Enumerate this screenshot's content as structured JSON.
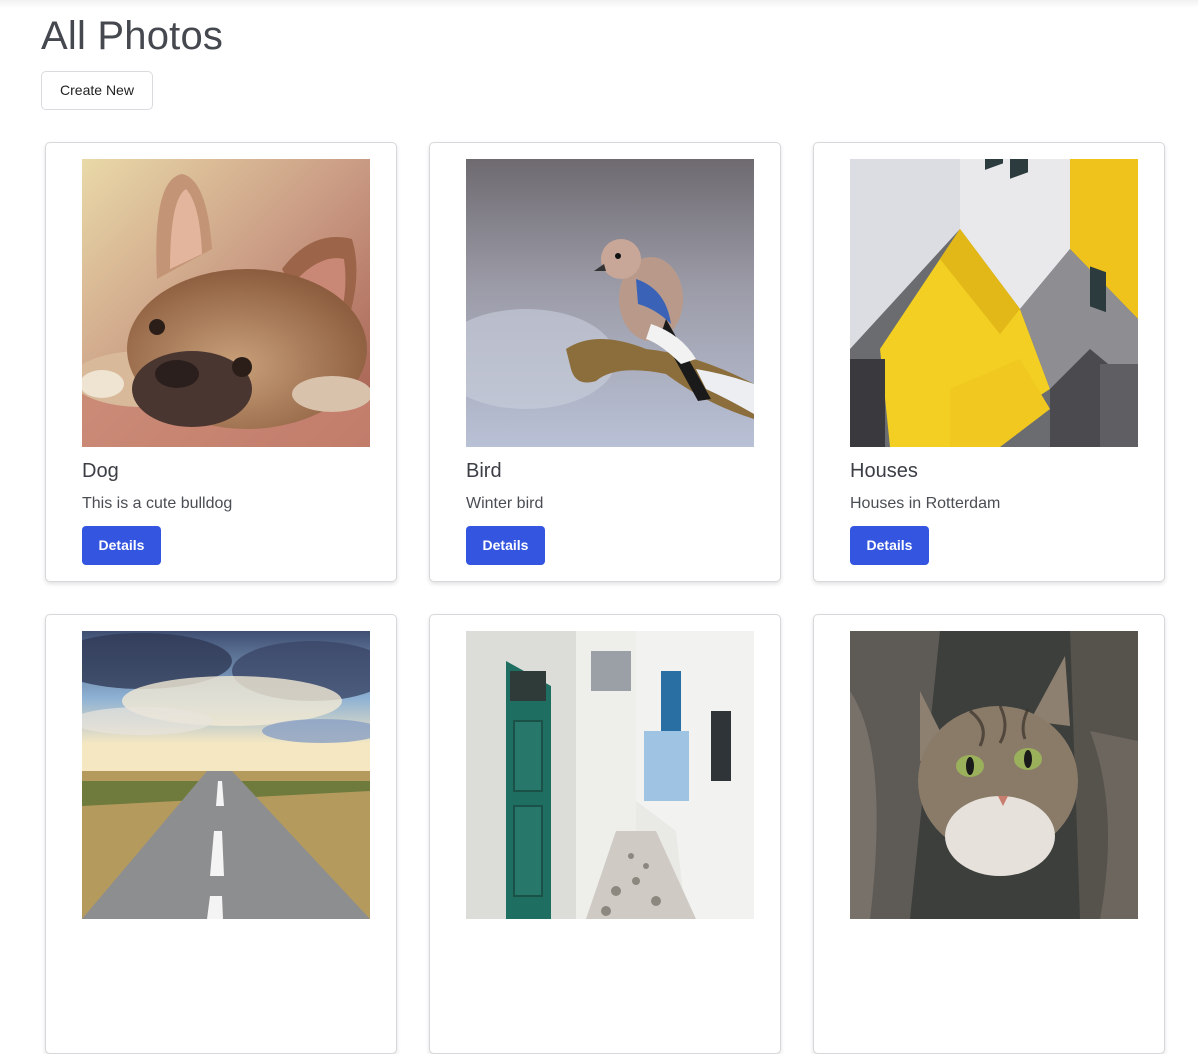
{
  "page": {
    "title": "All Photos",
    "create_label": "Create New"
  },
  "colors": {
    "accent": "#3455e0",
    "text": "#3b3f45",
    "border": "#d6d8db"
  },
  "photos": [
    {
      "title": "Dog",
      "description": "This is a cute bulldog",
      "button_label": "Details",
      "image": "french-bulldog-photo"
    },
    {
      "title": "Bird",
      "description": "Winter bird",
      "button_label": "Details",
      "image": "jay-bird-on-branch-photo"
    },
    {
      "title": "Houses",
      "description": "Houses in Rotterdam",
      "button_label": "Details",
      "image": "yellow-cube-houses-photo"
    },
    {
      "title": "",
      "description": "",
      "button_label": "",
      "image": "road-under-clouds-photo"
    },
    {
      "title": "",
      "description": "",
      "button_label": "",
      "image": "white-alley-photo"
    },
    {
      "title": "",
      "description": "",
      "button_label": "",
      "image": "tabby-kitten-photo"
    }
  ]
}
